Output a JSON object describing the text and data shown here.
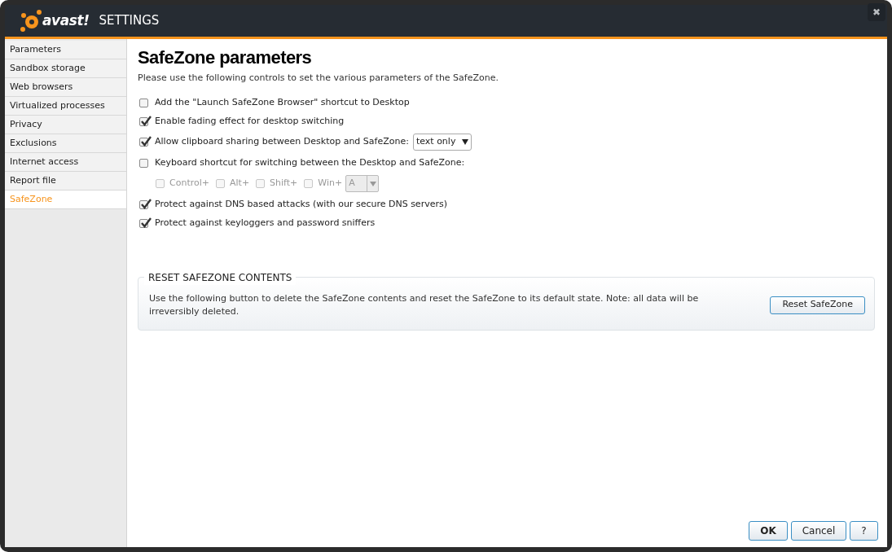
{
  "window": {
    "logo_text": "avast!",
    "title": "SETTINGS",
    "close": "✖"
  },
  "sidebar": {
    "items": [
      {
        "label": "Parameters",
        "selected": false
      },
      {
        "label": "Sandbox storage",
        "selected": false
      },
      {
        "label": "Web browsers",
        "selected": false
      },
      {
        "label": "Virtualized processes",
        "selected": false
      },
      {
        "label": "Privacy",
        "selected": false
      },
      {
        "label": "Exclusions",
        "selected": false
      },
      {
        "label": "Internet access",
        "selected": false
      },
      {
        "label": "Report file",
        "selected": false
      },
      {
        "label": "SafeZone",
        "selected": true
      }
    ]
  },
  "heading": "SafeZone parameters",
  "intro": "Please use the following controls to set the various parameters of the SafeZone.",
  "options": [
    {
      "kind": "checkbox",
      "label": "Add the \"Launch SafeZone Browser\" shortcut to Desktop",
      "checked": false
    },
    {
      "kind": "checkbox",
      "label": "Enable fading effect for desktop switching",
      "checked": true
    },
    {
      "kind": "select",
      "label": "Allow clipboard sharing between Desktop and SafeZone:",
      "checked": true,
      "value": "text only"
    },
    {
      "kind": "checkbox",
      "label": "Keyboard shortcut for switching between the Desktop and SafeZone:",
      "checked": false
    },
    {
      "kind": "keys",
      "disabled": true,
      "keys": [
        {
          "label": "Control+",
          "checked": false
        },
        {
          "label": "Alt+",
          "checked": false
        },
        {
          "label": "Shift+",
          "checked": false
        },
        {
          "label": "Win+",
          "checked": false
        }
      ],
      "value": "A"
    },
    {
      "kind": "checkbox",
      "label": "Protect against DNS based attacks (with our secure DNS servers)",
      "checked": true
    },
    {
      "kind": "checkbox",
      "label": "Protect against keyloggers and password sniffers",
      "checked": true
    }
  ],
  "reset": {
    "title": "RESET SAFEZONE CONTENTS",
    "text": "Use the following button to delete the SafeZone contents and reset the SafeZone to its default state. Note: all data will be irreversibly deleted.",
    "button": "Reset SafeZone"
  },
  "buttons": [
    {
      "label": "OK",
      "kind": "default"
    },
    {
      "label": "Cancel",
      "kind": "normal"
    },
    {
      "label": "?",
      "kind": "normal"
    }
  ]
}
